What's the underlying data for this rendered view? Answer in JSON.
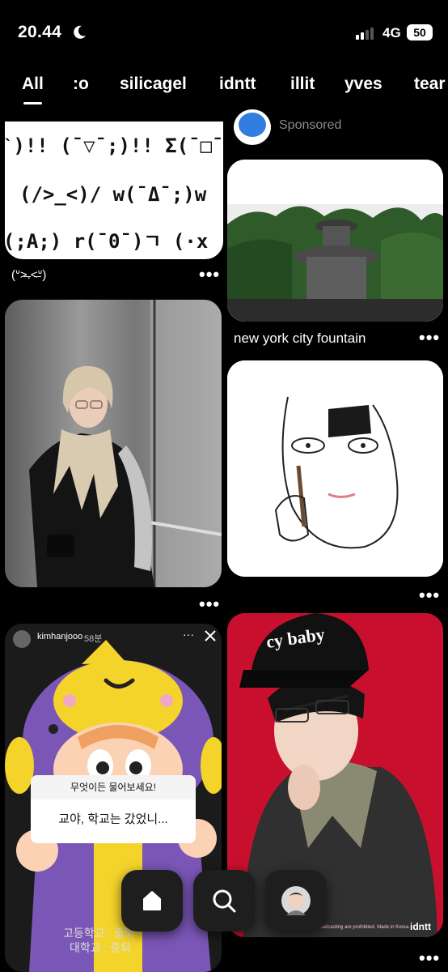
{
  "status": {
    "time": "20.44",
    "network": "4G",
    "battery": "50"
  },
  "tabs": [
    "All",
    ":o",
    "silicagel",
    "idntt",
    "illit",
    "yves",
    "tear"
  ],
  "sponsor": {
    "label": "Sponsored"
  },
  "pins": {
    "kaomoji": {
      "lines": [
        "ˋ)!!  (¯▽¯;)!!  Σ(¯□¯",
        "(/>_<)/  w(¯Δ¯;)w",
        "(;A;)  r(¯0¯)ㄱ  (·x"
      ],
      "caption": "(ᐡ˃̶.˂̶ᐡ)"
    },
    "fountain": {
      "caption": "new york city fountain"
    },
    "story": {
      "username": "kimhanjooo",
      "time_ago": "58분",
      "question": "무엇이든 물어보세요!",
      "answer": "교야, 학교는 갔었니...",
      "line1": "고등학교  :  중퇴",
      "line2": "대학교  :  중퇴"
    },
    "cap": {
      "text": "cy baby",
      "brand": "idntt",
      "fine_print": "nce and broadcasting are prohibited. Made in Korea."
    }
  },
  "more_label": "•••",
  "nav": {
    "home": "home-icon",
    "search": "search-icon",
    "profile": "avatar"
  },
  "colors": {
    "background": "#000000",
    "card_red": "#c8102e",
    "accent_white": "#ffffff"
  }
}
